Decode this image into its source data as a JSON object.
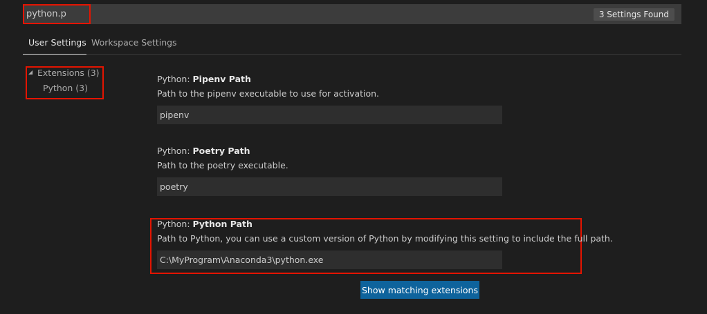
{
  "search": {
    "value": "python.p",
    "results_badge": "3 Settings Found"
  },
  "tabs": [
    {
      "label": "User Settings",
      "active": true
    },
    {
      "label": "Workspace Settings",
      "active": false
    }
  ],
  "toc": {
    "group": "Extensions (3)",
    "item": "Python (3)"
  },
  "settings": [
    {
      "prefix": "Python: ",
      "name": "Pipenv Path",
      "description": "Path to the pipenv executable to use for activation.",
      "value": "pipenv"
    },
    {
      "prefix": "Python: ",
      "name": "Poetry Path",
      "description": "Path to the poetry executable.",
      "value": "poetry"
    },
    {
      "prefix": "Python: ",
      "name": "Python Path",
      "description": "Path to Python, you can use a custom version of Python by modifying this setting to include the full path.",
      "value": "C:\\MyProgram\\Anaconda3\\python.exe"
    }
  ],
  "show_extensions_label": "Show matching extensions",
  "colors": {
    "highlight": "#e51400",
    "button": "#0e639c",
    "background": "#1e1e1e"
  }
}
